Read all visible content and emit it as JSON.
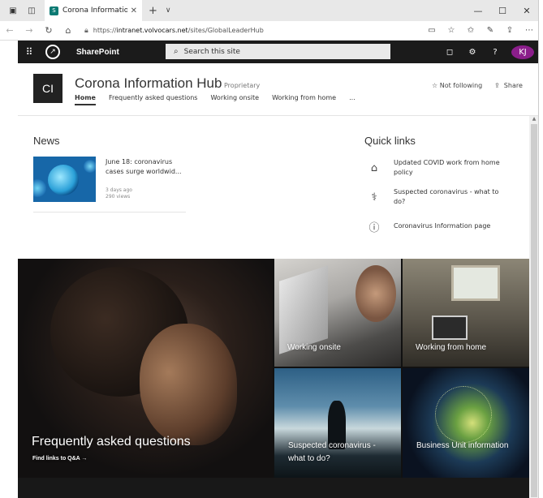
{
  "browser": {
    "tab_title": "Corona Information Hul",
    "url_prefix": "https://",
    "url_domain": "intranet.volvocars.net",
    "url_path": "/sites/GlobalLeaderHub"
  },
  "sharepoint": {
    "app_name": "SharePoint",
    "search_placeholder": "Search this site",
    "avatar_initials": "KJ"
  },
  "site": {
    "icon_text": "CI",
    "title": "Corona Information Hub",
    "tag": "Proprietary",
    "follow_label": "Not following",
    "share_label": "Share",
    "nav": [
      "Home",
      "Frequently asked questions",
      "Working onsite",
      "Working from home",
      "..."
    ]
  },
  "news": {
    "heading": "News",
    "item_title_line1": "June 18: coronavirus",
    "item_title_line2": "cases surge worldwid...",
    "item_age": "3 days ago",
    "item_views": "290 views"
  },
  "quick_links": {
    "heading": "Quick links",
    "items": [
      {
        "label": "Updated COVID work from home policy",
        "icon": "home-icon"
      },
      {
        "label": "Suspected coronavirus - what to do?",
        "icon": "stethoscope-icon"
      },
      {
        "label": "Coronavirus Information page",
        "icon": "info-icon"
      }
    ]
  },
  "hero": {
    "main_title": "Frequently asked questions",
    "main_link": "Find links to Q&A →",
    "tiles": [
      "Working onsite",
      "Working from home",
      "Suspected coronavirus - what to do?",
      "Business Unit information"
    ]
  }
}
